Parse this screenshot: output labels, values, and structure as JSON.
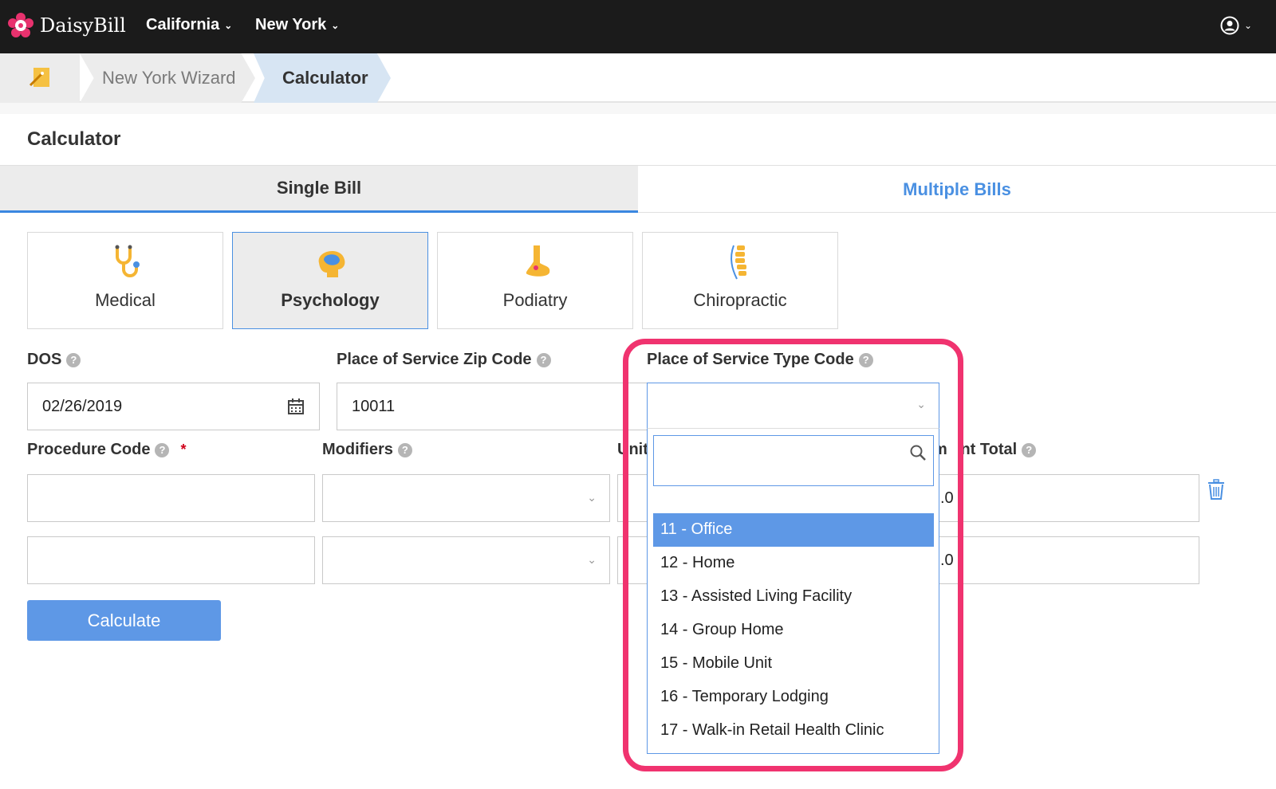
{
  "topnav": {
    "logo_text": "DaisyBill",
    "menu_california": "California",
    "menu_new_york": "New York"
  },
  "breadcrumb": {
    "wizard": "New York Wizard",
    "current": "Calculator"
  },
  "page": {
    "title": "Calculator"
  },
  "tabs": {
    "single": "Single Bill",
    "multiple": "Multiple Bills"
  },
  "specialties": [
    {
      "label": "Medical",
      "icon": "stethoscope-icon"
    },
    {
      "label": "Psychology",
      "icon": "brain-icon"
    },
    {
      "label": "Podiatry",
      "icon": "foot-icon"
    },
    {
      "label": "Chiropractic",
      "icon": "spine-icon"
    }
  ],
  "form": {
    "dos_label": "DOS",
    "dos_value": "02/26/2019",
    "zip_label": "Place of Service Zip Code",
    "zip_value": "10011",
    "pos_type_label": "Place of Service Type Code",
    "procedure_label": "Procedure Code",
    "required_mark": "*",
    "modifiers_label": "Modifiers",
    "units_label_partial": "Unit",
    "total_label_partial": "m   nt Total",
    "total_value_partial_1": ".0",
    "total_value_partial_2": ".0",
    "calculate_button": "Calculate"
  },
  "dropdown": {
    "options": [
      "11 - Office",
      "12 - Home",
      "13 - Assisted Living Facility",
      "14 - Group Home",
      "15 - Mobile Unit",
      "16 - Temporary Lodging",
      "17 - Walk-in Retail Health Clinic"
    ],
    "selected_index": 0
  },
  "colors": {
    "accent": "#5e98e6",
    "highlight_box": "#f0336f",
    "topbar": "#1b1b1b"
  }
}
